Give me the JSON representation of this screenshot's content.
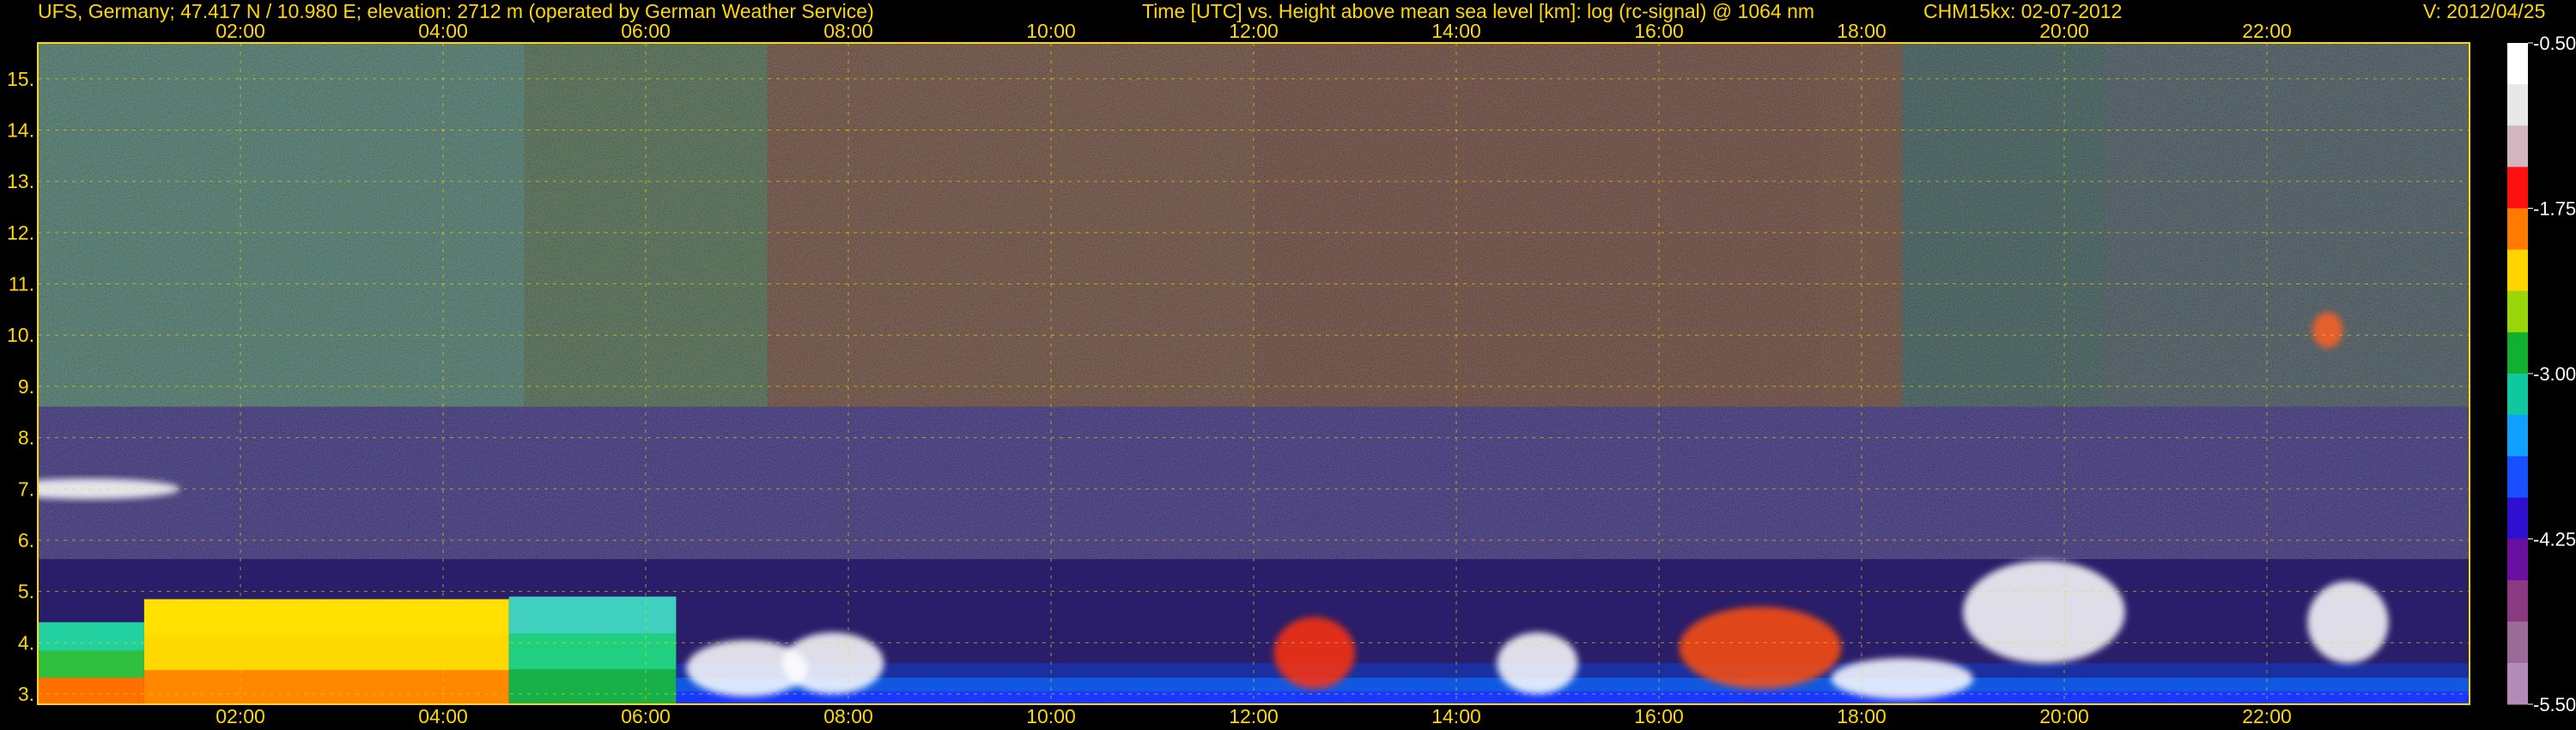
{
  "header": {
    "site": "UFS, Germany; 47.417 N / 10.980 E; elevation: 2712 m  (operated by German Weather Service)",
    "axes": "Time [UTC] vs. Height above mean sea level [km]: log (rc-signal) @ 1064 nm",
    "instrument": "CHM15kx: 02-07-2012",
    "version": "V: 2012/04/25"
  },
  "chart_data": {
    "type": "heatmap",
    "title": "Time [UTC] vs. Height above mean sea level [km]: log (rc-signal) @ 1064 nm",
    "xlabel": "Time [UTC]",
    "ylabel": "Height above mean sea level [km]",
    "xlim": [
      "00:00",
      "24:00"
    ],
    "ylim": [
      2.8,
      15.7
    ],
    "x_ticks": [
      "02:00",
      "04:00",
      "06:00",
      "08:00",
      "10:00",
      "12:00",
      "14:00",
      "16:00",
      "18:00",
      "20:00",
      "22:00"
    ],
    "y_ticks": [
      "3.",
      "4.",
      "5.",
      "6.",
      "7.",
      "8.",
      "9.",
      "10.",
      "11.",
      "12.",
      "13.",
      "14.",
      "15."
    ],
    "grid": true,
    "colorbar": {
      "min": -5.5,
      "max": -0.5,
      "ticks": [
        "-0.50",
        "-1.75",
        "-3.00",
        "-4.25",
        "-5.50"
      ],
      "colors": [
        "#ffffff",
        "#e8e8e8",
        "#d3b5c0",
        "#ff1010",
        "#ff7a00",
        "#ffd500",
        "#9ad60c",
        "#10b030",
        "#10c8a0",
        "#10a0ff",
        "#1850ff",
        "#3010d0",
        "#6a10a0",
        "#8a3a80",
        "#9a6a98",
        "#b48ab8"
      ]
    },
    "layers": [
      {
        "name": "lower aerosol layer",
        "segments": [
          {
            "start": 0.0,
            "end": 1.05,
            "top": 4.4,
            "colors": [
              "#ff7000",
              "#30c040",
              "#22d0a0"
            ]
          },
          {
            "start": 1.05,
            "end": 4.65,
            "top": 4.85,
            "colors": [
              "#ff8800",
              "#ffd800",
              "#ffe000"
            ]
          },
          {
            "start": 4.65,
            "end": 6.3,
            "top": 4.9,
            "colors": [
              "#18b048",
              "#20d080",
              "#40d0c0"
            ]
          },
          {
            "start": 6.3,
            "end": 24.0,
            "top": 3.6,
            "colors": [
              "#1838ff",
              "#1058e0",
              "#1a30a0"
            ]
          }
        ]
      },
      {
        "name": "clouds",
        "blobs": [
          {
            "t": 0.5,
            "h": 7.0,
            "w": 1.8,
            "d": 0.4,
            "color": "#ffffff"
          },
          {
            "t": 7.0,
            "h": 3.5,
            "w": 1.2,
            "d": 1.1,
            "color": "#ffffff"
          },
          {
            "t": 7.85,
            "h": 3.6,
            "w": 1.0,
            "d": 1.2,
            "color": "#ffffff"
          },
          {
            "t": 12.6,
            "h": 3.8,
            "w": 0.8,
            "d": 1.4,
            "color": "#ff3010"
          },
          {
            "t": 14.8,
            "h": 3.6,
            "w": 0.8,
            "d": 1.2,
            "color": "#ffffff"
          },
          {
            "t": 17.0,
            "h": 3.9,
            "w": 1.6,
            "d": 1.6,
            "color": "#ff5010"
          },
          {
            "t": 18.4,
            "h": 3.3,
            "w": 1.4,
            "d": 0.8,
            "color": "#ffffff"
          },
          {
            "t": 19.8,
            "h": 4.6,
            "w": 1.6,
            "d": 2.0,
            "color": "#ffffff"
          },
          {
            "t": 22.8,
            "h": 4.4,
            "w": 0.8,
            "d": 1.6,
            "color": "#ffffff"
          },
          {
            "t": 22.6,
            "h": 10.1,
            "w": 0.3,
            "d": 0.7,
            "color": "#ff6020"
          }
        ]
      }
    ]
  }
}
